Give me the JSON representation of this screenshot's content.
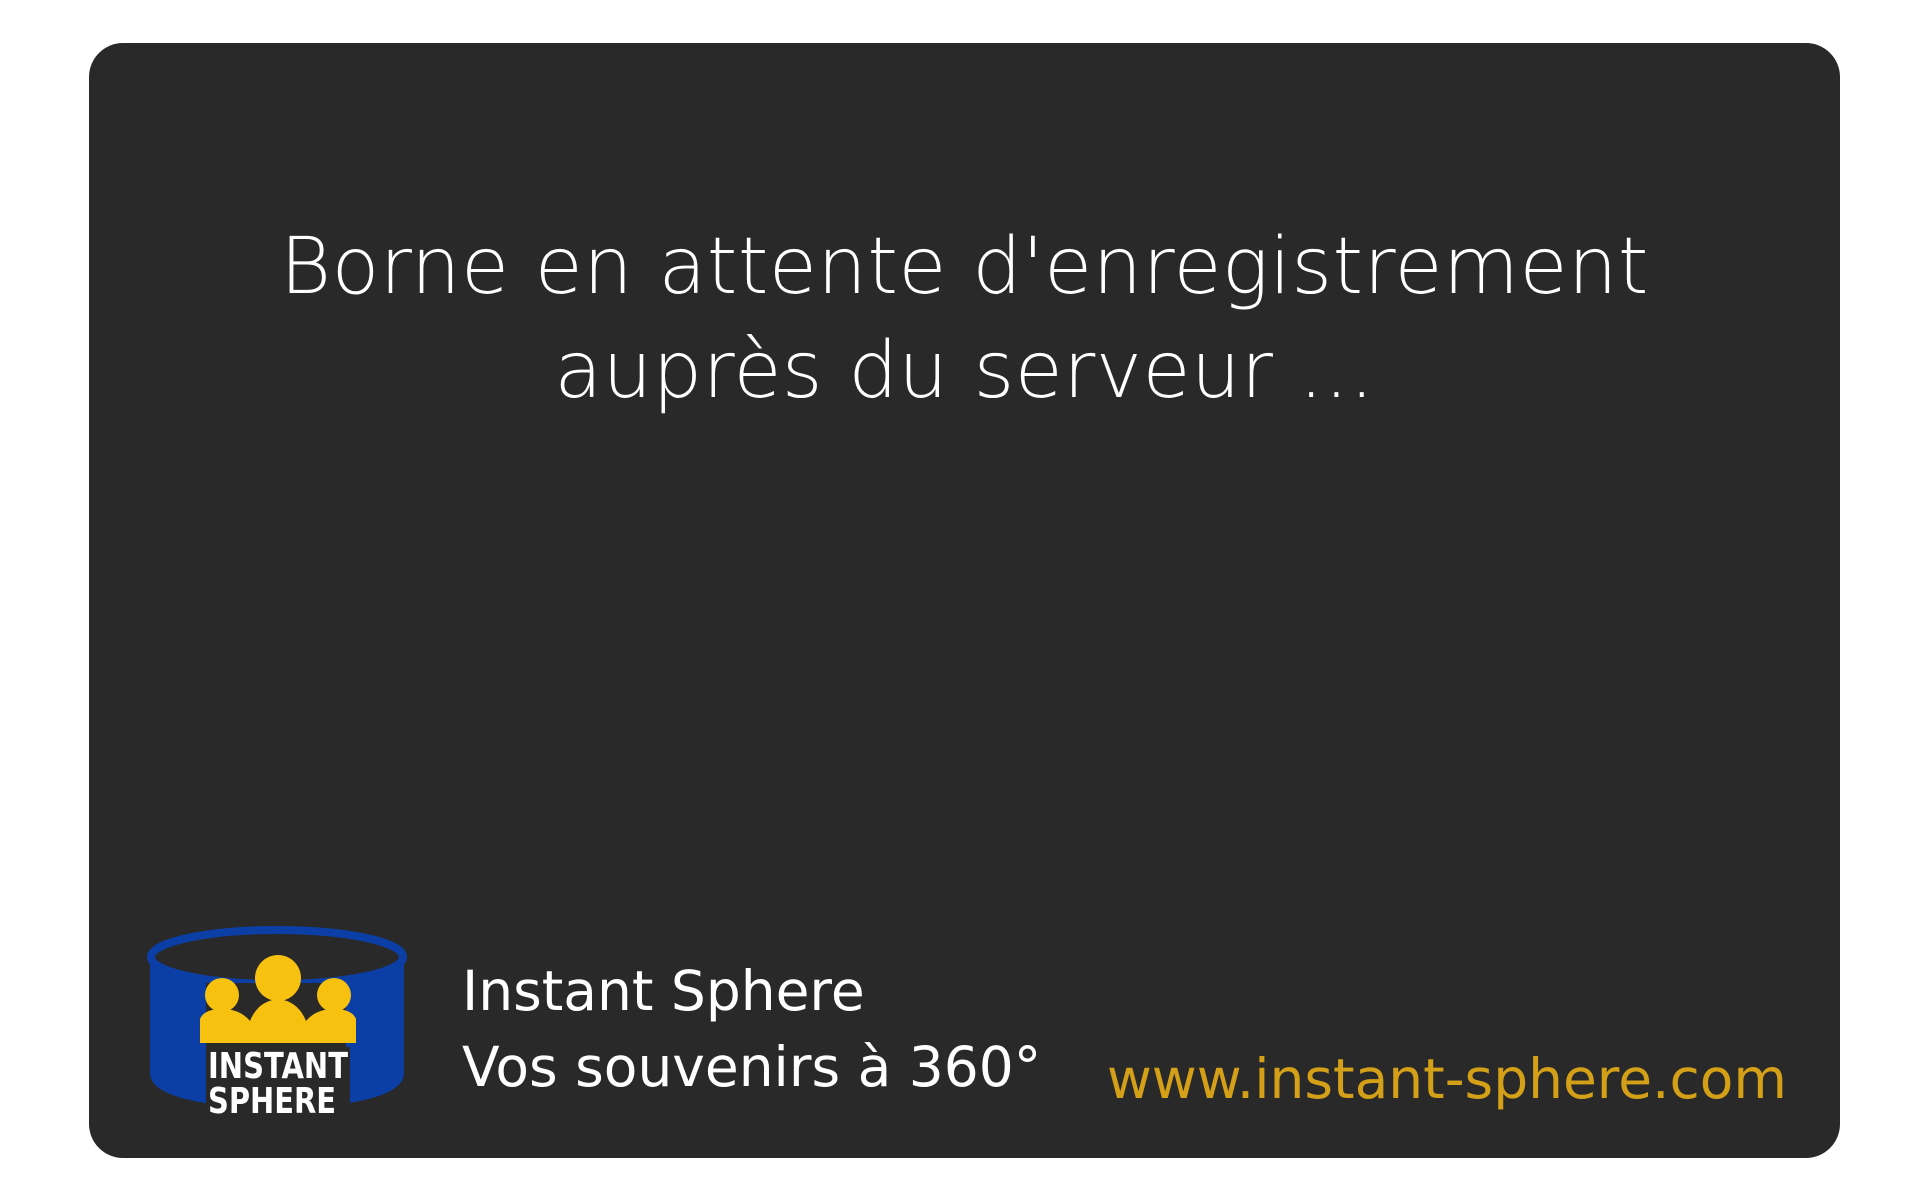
{
  "message": {
    "line1": "Borne en attente d'enregistrement",
    "line2": "auprès du serveur ..."
  },
  "logo": {
    "icon": "instant-sphere-logo",
    "line1": "INSTANT",
    "line2": "SPHERE",
    "colors": {
      "blue": "#0b3fa6",
      "yellow": "#f7c10f"
    }
  },
  "brand": {
    "name": "Instant Sphere",
    "tagline": "Vos souvenirs à 360°"
  },
  "website": "www.instant-sphere.com",
  "colors": {
    "background": "#292929",
    "text": "#ffffff",
    "accent": "#d4a017"
  }
}
